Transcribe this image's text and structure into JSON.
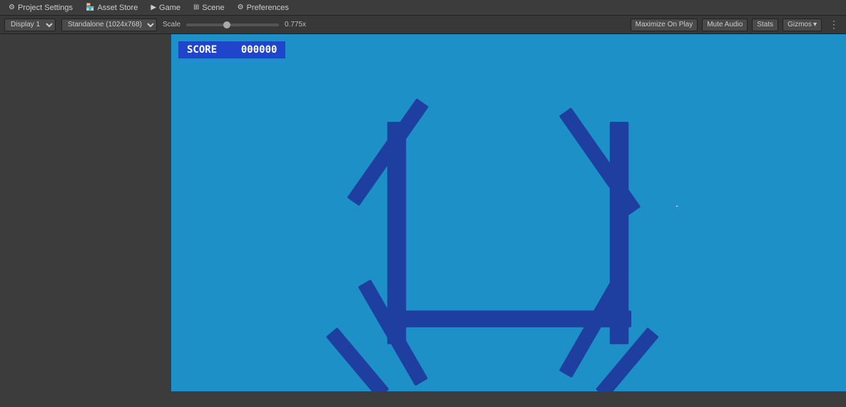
{
  "menubar": {
    "items": [
      {
        "label": "Project Settings",
        "icon": "⚙"
      },
      {
        "label": "Asset Store",
        "icon": "🏪"
      },
      {
        "label": "Game",
        "icon": "▶"
      },
      {
        "label": "Scene",
        "icon": "⊞"
      },
      {
        "label": "Preferences",
        "icon": "⚙"
      }
    ]
  },
  "toolbar": {
    "display_label": "Display 1",
    "resolution_label": "Standalone (1024x768)",
    "scale_label": "Scale",
    "scale_value": "0.775x",
    "maximize_label": "Maximize On Play",
    "mute_label": "Mute Audio",
    "stats_label": "Stats",
    "gizmos_label": "Gizmos",
    "more_icon": "⋮"
  },
  "game": {
    "score_label": "SCORE",
    "score_value": "000000"
  },
  "colors": {
    "sky_blue": "#1e90c8",
    "dark_blue": "#1a3a9e",
    "medium_blue": "#2855b8",
    "score_bg": "#2044cc"
  }
}
